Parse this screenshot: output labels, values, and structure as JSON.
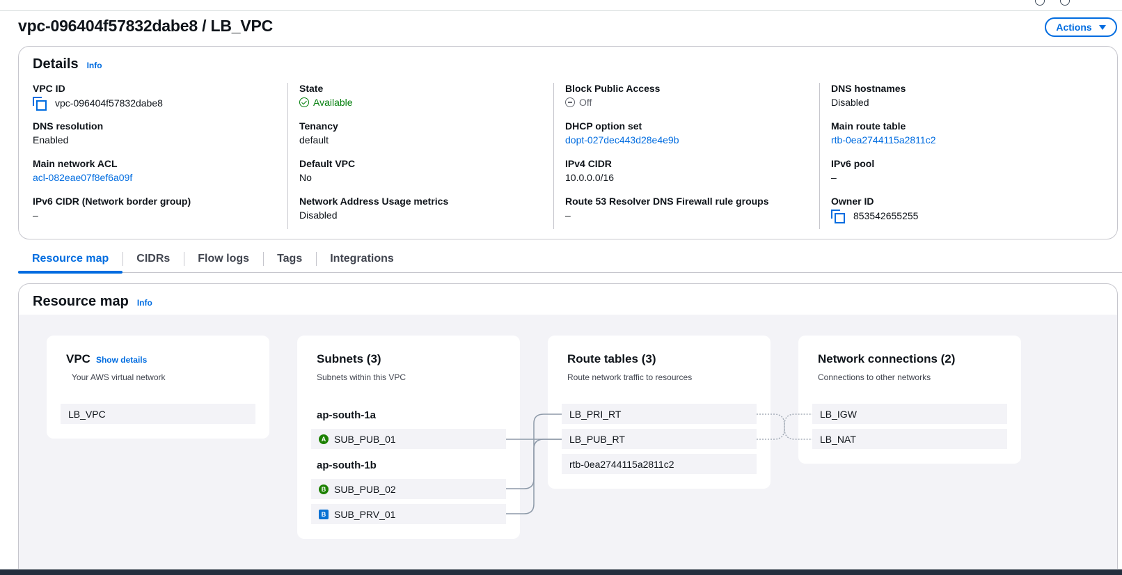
{
  "page": {
    "title": "vpc-096404f57832dabe8 / LB_VPC",
    "actions_label": "Actions"
  },
  "details": {
    "title": "Details",
    "info_label": "Info",
    "fields": {
      "vpc_id": {
        "label": "VPC ID",
        "value": "vpc-096404f57832dabe8"
      },
      "dns_resolution": {
        "label": "DNS resolution",
        "value": "Enabled"
      },
      "main_network_acl": {
        "label": "Main network ACL",
        "value": "acl-082eae07f8ef6a09f"
      },
      "ipv6_cidr": {
        "label": "IPv6 CIDR (Network border group)",
        "value": "–"
      },
      "state": {
        "label": "State",
        "value": "Available"
      },
      "tenancy": {
        "label": "Tenancy",
        "value": "default"
      },
      "default_vpc": {
        "label": "Default VPC",
        "value": "No"
      },
      "nau_metrics": {
        "label": "Network Address Usage metrics",
        "value": "Disabled"
      },
      "block_public_access": {
        "label": "Block Public Access",
        "value": "Off"
      },
      "dhcp_option_set": {
        "label": "DHCP option set",
        "value": "dopt-027dec443d28e4e9b"
      },
      "ipv4_cidr": {
        "label": "IPv4 CIDR",
        "value": "10.0.0.0/16"
      },
      "r53_firewall": {
        "label": "Route 53 Resolver DNS Firewall rule groups",
        "value": "–"
      },
      "dns_hostnames": {
        "label": "DNS hostnames",
        "value": "Disabled"
      },
      "main_route_table": {
        "label": "Main route table",
        "value": "rtb-0ea2744115a2811c2"
      },
      "ipv6_pool": {
        "label": "IPv6 pool",
        "value": "–"
      },
      "owner_id": {
        "label": "Owner ID",
        "value": "853542655255"
      }
    }
  },
  "tabs": [
    "Resource map",
    "CIDRs",
    "Flow logs",
    "Tags",
    "Integrations"
  ],
  "resource_map": {
    "title": "Resource map",
    "info_label": "Info",
    "vpc": {
      "title": "VPC",
      "show_details": "Show details",
      "subtitle": "Your AWS virtual network",
      "items": [
        "LB_VPC"
      ]
    },
    "subnets": {
      "title": "Subnets (3)",
      "subtitle": "Subnets within this VPC",
      "groups": [
        {
          "zone": "ap-south-1a",
          "items": [
            {
              "name": "SUB_PUB_01",
              "badge": "A"
            }
          ]
        },
        {
          "zone": "ap-south-1b",
          "items": [
            {
              "name": "SUB_PUB_02",
              "badge": "B"
            },
            {
              "name": "SUB_PRV_01",
              "badge": "B"
            }
          ]
        }
      ]
    },
    "route_tables": {
      "title": "Route tables (3)",
      "subtitle": "Route network traffic to resources",
      "items": [
        "LB_PRI_RT",
        "LB_PUB_RT",
        "rtb-0ea2744115a2811c2"
      ]
    },
    "network_connections": {
      "title": "Network connections (2)",
      "subtitle": "Connections to other networks",
      "items": [
        "LB_IGW",
        "LB_NAT"
      ]
    }
  },
  "colors": {
    "link": "#006ce0",
    "success": "#037f0c",
    "badge_public": "#1d8102",
    "badge_private": "#0972d3",
    "canvas_bg": "#f3f3f7"
  }
}
